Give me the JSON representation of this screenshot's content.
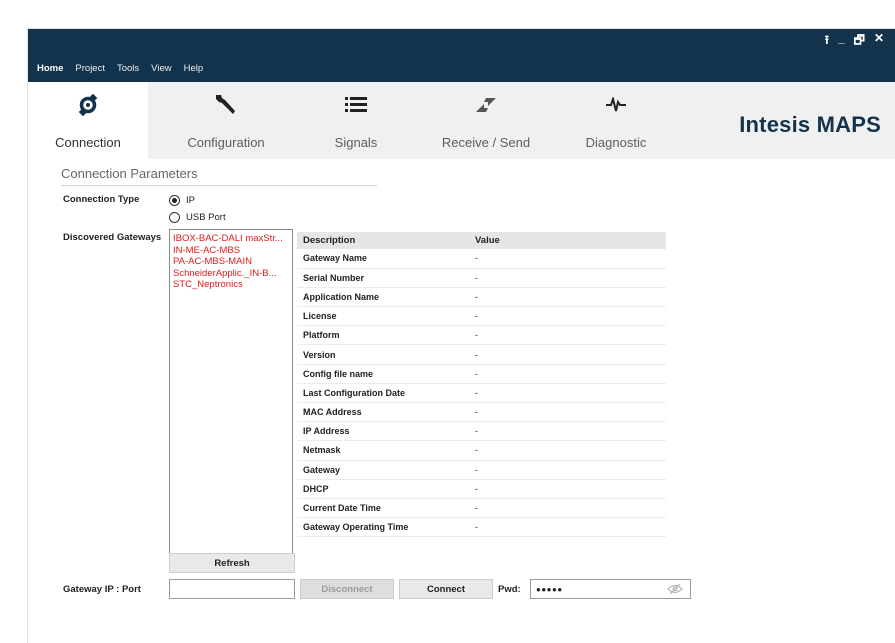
{
  "window": {
    "controls": [
      "upload-icon",
      "minimize-icon",
      "restore-icon",
      "close-icon"
    ],
    "control_glyphs": [
      "⭱",
      "_",
      "🗗",
      "✕"
    ]
  },
  "menu": {
    "items": [
      "Home",
      "Project",
      "Tools",
      "View",
      "Help"
    ],
    "active": "Home"
  },
  "ribbon": {
    "tabs": [
      {
        "label": "Connection",
        "icon": "connection-icon",
        "active": true
      },
      {
        "label": "Configuration",
        "icon": "wrench-icon",
        "active": false
      },
      {
        "label": "Signals",
        "icon": "list-icon",
        "active": false
      },
      {
        "label": "Receive / Send",
        "icon": "transfer-icon",
        "active": false
      },
      {
        "label": "Diagnostic",
        "icon": "pulse-icon",
        "active": false
      }
    ],
    "brand": "Intesis MAPS"
  },
  "connection_params": {
    "title": "Connection Parameters",
    "connection_type_label": "Connection Type",
    "options": [
      {
        "label": "IP",
        "selected": true
      },
      {
        "label": "USB Port",
        "selected": false
      }
    ],
    "discovered_label": "Discovered Gateways",
    "gateways": [
      "IBOX-BAC-DALI maxStr...",
      "IN-ME-AC-MBS",
      "PA-AC-MBS-MAIN",
      "SchneiderApplic._IN-B...",
      "STC_Neptronics"
    ],
    "table": {
      "headers": [
        "Description",
        "Value"
      ],
      "rows": [
        [
          "Gateway Name",
          "-"
        ],
        [
          "Serial Number",
          "-"
        ],
        [
          "Application Name",
          "-"
        ],
        [
          "License",
          "-"
        ],
        [
          "Platform",
          "-"
        ],
        [
          "Version",
          "-"
        ],
        [
          "Config file name",
          "-"
        ],
        [
          "Last Configuration Date",
          "-"
        ],
        [
          "MAC Address",
          "-"
        ],
        [
          "IP Address",
          "-"
        ],
        [
          "Netmask",
          "-"
        ],
        [
          "Gateway",
          "-"
        ],
        [
          "DHCP",
          "-"
        ],
        [
          "Current Date Time",
          "-"
        ],
        [
          "Gateway Operating Time",
          "-"
        ]
      ]
    },
    "refresh_label": "Refresh",
    "gateway_ip_label": "Gateway IP : Port",
    "gateway_ip_value": "",
    "disconnect_label": "Disconnect",
    "connect_label": "Connect",
    "pwd_label": "Pwd:",
    "pwd_value": "●●●●●"
  },
  "colors": {
    "header": "#13334c",
    "gateway_text": "#e01b1b"
  }
}
